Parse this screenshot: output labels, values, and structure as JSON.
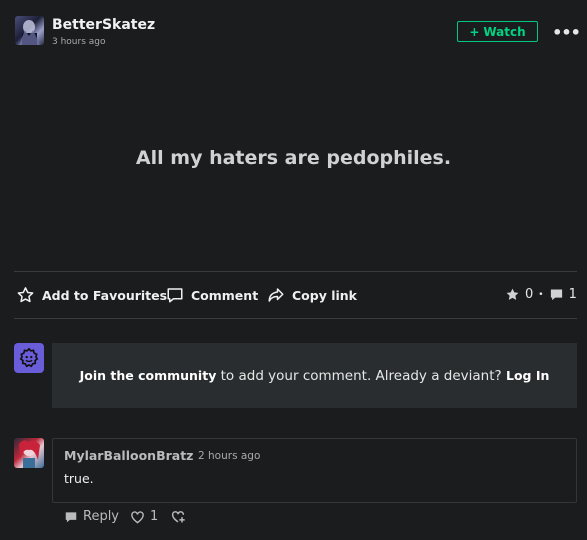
{
  "post": {
    "author": "BetterSkatez",
    "time": "3 hours ago",
    "watch_label": "Watch",
    "watch_prefix": "+",
    "more_label": "•••",
    "text": "All my haters are pedophiles."
  },
  "actions": {
    "favourite_label": "Add to Favourites",
    "comment_label": "Comment",
    "copy_label": "Copy link",
    "favourites_count": "0",
    "separator": "•",
    "comments_count": "1"
  },
  "join": {
    "link_text": "Join the community",
    "middle_text": " to add your comment. Already a deviant? ",
    "login_text": "Log In"
  },
  "comment": {
    "author": "MylarBalloonBratz",
    "time": "2 hours ago",
    "text": "true.",
    "reply_label": "Reply",
    "likes_count": "1"
  },
  "colors": {
    "background": "#1a1c1e",
    "accent_green": "#00d483",
    "community_icon": "#6a5dd9",
    "panel": "#2a2d30"
  },
  "icons": [
    "star-outline-icon",
    "comment-icon",
    "share-arrow-icon",
    "star-icon",
    "speech-bubble-icon",
    "community-logo-icon",
    "reply-icon",
    "heart-icon",
    "add-reaction-icon"
  ]
}
